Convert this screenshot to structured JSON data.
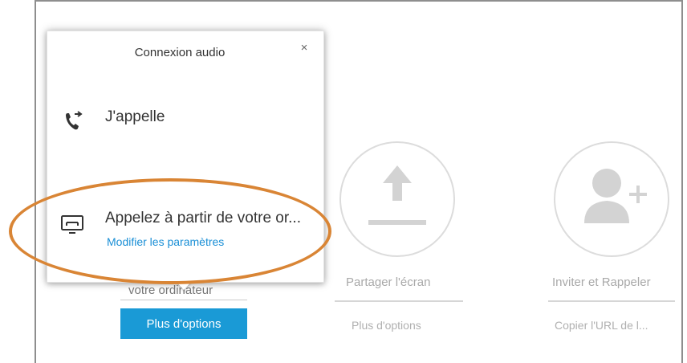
{
  "popup": {
    "title": "Connexion audio",
    "close": "×",
    "options": [
      {
        "label": "J'appelle",
        "icon": "phone-outgoing-icon"
      },
      {
        "label": "Appelez à partir de votre or...",
        "sub": "Modifier les paramètres",
        "icon": "computer-audio-icon"
      }
    ]
  },
  "left_action": {
    "label": "votre ordinateur",
    "button": "Plus d'options"
  },
  "share_action": {
    "label": "Partager l'écran",
    "more": "Plus d'options",
    "icon": "upload-arrow-icon"
  },
  "invite_action": {
    "label": "Inviter et Rappeler",
    "more": "Copier l'URL de l...",
    "icon": "add-person-icon"
  },
  "colors": {
    "accent": "#1a9ad6",
    "highlight": "#d98535",
    "link": "#1a8fd6"
  }
}
